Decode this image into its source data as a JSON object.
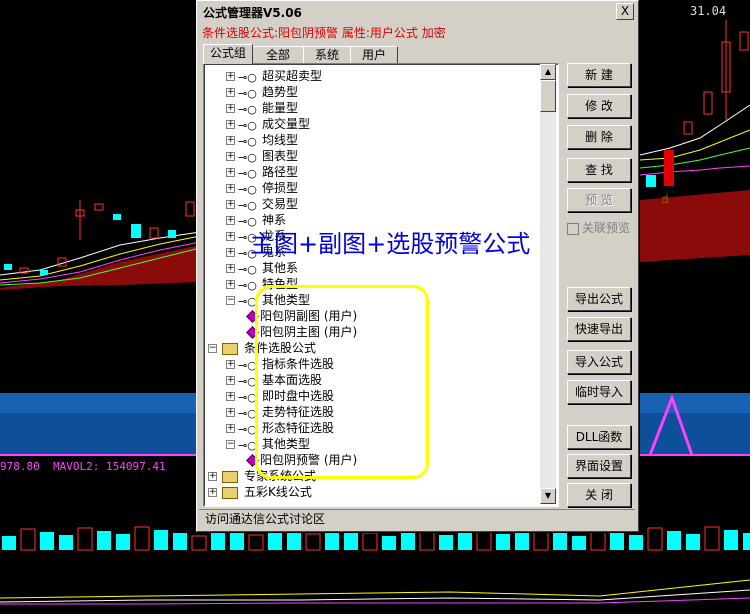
{
  "background": {
    "mavol_line": "978.80  MAVOL2: 154097.41",
    "price_label": "31.04"
  },
  "window": {
    "title": "公式管理器V5.06",
    "close_glyph": "X",
    "info_text": "条件选股公式:阳包阴预警  属性:用户公式  加密",
    "tabs": [
      "公式组",
      "全部",
      "系统",
      "用户"
    ],
    "tree": [
      {
        "label": "超买超卖型",
        "type": "group",
        "level": 2,
        "expanded": false
      },
      {
        "label": "趋势型",
        "type": "group",
        "level": 2,
        "expanded": false
      },
      {
        "label": "能量型",
        "type": "group",
        "level": 2,
        "expanded": false
      },
      {
        "label": "成交量型",
        "type": "group",
        "level": 2,
        "expanded": false
      },
      {
        "label": "均线型",
        "type": "group",
        "level": 2,
        "expanded": false
      },
      {
        "label": "图表型",
        "type": "group",
        "level": 2,
        "expanded": false
      },
      {
        "label": "路径型",
        "type": "group",
        "level": 2,
        "expanded": false
      },
      {
        "label": "停损型",
        "type": "group",
        "level": 2,
        "expanded": false
      },
      {
        "label": "交易型",
        "type": "group",
        "level": 2,
        "expanded": false
      },
      {
        "label": "神系",
        "type": "group",
        "level": 2,
        "expanded": false
      },
      {
        "label": "龙系",
        "type": "group",
        "level": 2,
        "expanded": false
      },
      {
        "label": "鬼系",
        "type": "group",
        "level": 2,
        "expanded": false
      },
      {
        "label": "其他系",
        "type": "group",
        "level": 2,
        "expanded": false
      },
      {
        "label": "特色型",
        "type": "group",
        "level": 2,
        "expanded": false
      },
      {
        "label": "其他类型",
        "type": "group",
        "level": 2,
        "expanded": true
      },
      {
        "label": "阳包阴副图  (用户)",
        "type": "formula",
        "level": 3
      },
      {
        "label": "阳包阴主图  (用户)",
        "type": "formula",
        "level": 3
      },
      {
        "label": "条件选股公式",
        "type": "folder",
        "level": 1,
        "expanded": true
      },
      {
        "label": "指标条件选股",
        "type": "group",
        "level": 2,
        "expanded": false
      },
      {
        "label": "基本面选股",
        "type": "group",
        "level": 2,
        "expanded": false
      },
      {
        "label": "即时盘中选股",
        "type": "group",
        "level": 2,
        "expanded": false
      },
      {
        "label": "走势特征选股",
        "type": "group",
        "level": 2,
        "expanded": false
      },
      {
        "label": "形态特征选股",
        "type": "group",
        "level": 2,
        "expanded": false
      },
      {
        "label": "其他类型",
        "type": "group",
        "level": 2,
        "expanded": true
      },
      {
        "label": "阳包阴预警  (用户)",
        "type": "formula",
        "level": 3
      },
      {
        "label": "专家系统公式",
        "type": "folder",
        "level": 1,
        "expanded": false
      },
      {
        "label": "五彩K线公式",
        "type": "folder",
        "level": 1,
        "expanded": false
      }
    ],
    "buttons": {
      "new": "新  建",
      "edit": "修  改",
      "delete": "删  除",
      "find": "查  找",
      "preview": "预  览",
      "link_preview": "关联预览",
      "export": "导出公式",
      "quick_export": "快速导出",
      "import": "导入公式",
      "temp_import": "临时导入",
      "dll": "DLL函数",
      "ui_settings": "界面设置",
      "close": "关  闭"
    },
    "status": "访问通达信公式讨论区"
  },
  "overlay_text": "主图+副图+选股预警公式",
  "colors": {
    "info": "#e00000",
    "overlay": "#0000e0",
    "highlight": "#ffff00",
    "dialog": "#d4d0c8"
  }
}
